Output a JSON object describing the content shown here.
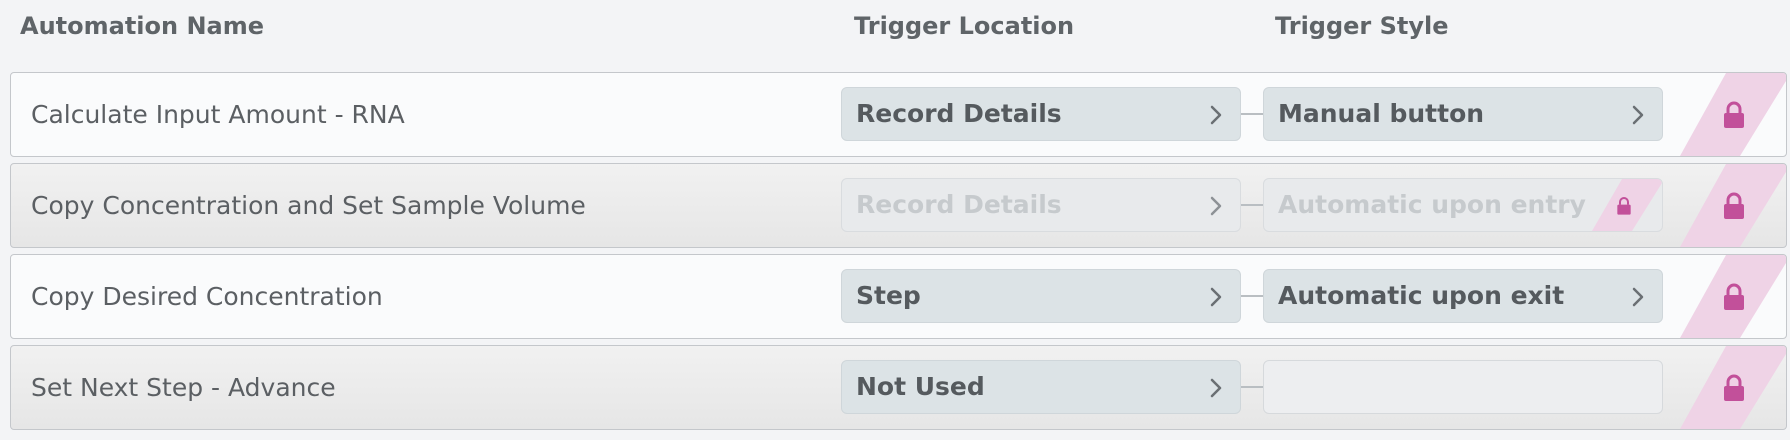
{
  "header": {
    "name": "Automation Name",
    "location": "Trigger Location",
    "style": "Trigger Style"
  },
  "rows": [
    {
      "name": "Calculate Input Amount - RNA",
      "location": "Record Details",
      "style": "Manual button",
      "state": "active"
    },
    {
      "name": "Copy Concentration and Set Sample Volume",
      "location": "Record Details",
      "style": "Automatic upon entry",
      "state": "disabled"
    },
    {
      "name": "Copy Desired Concentration",
      "location": "Step",
      "style": "Automatic upon exit",
      "state": "active"
    },
    {
      "name": "Set Next Step - Advance",
      "location": "Not Used",
      "style": "",
      "state": "disabled"
    }
  ],
  "icons": {
    "chevron": "chevron-right-icon",
    "lock": "lock-icon"
  },
  "colors": {
    "lock": "#c2509a",
    "lock_stripe": "#efd3e6",
    "pill": "#dce3e6"
  }
}
